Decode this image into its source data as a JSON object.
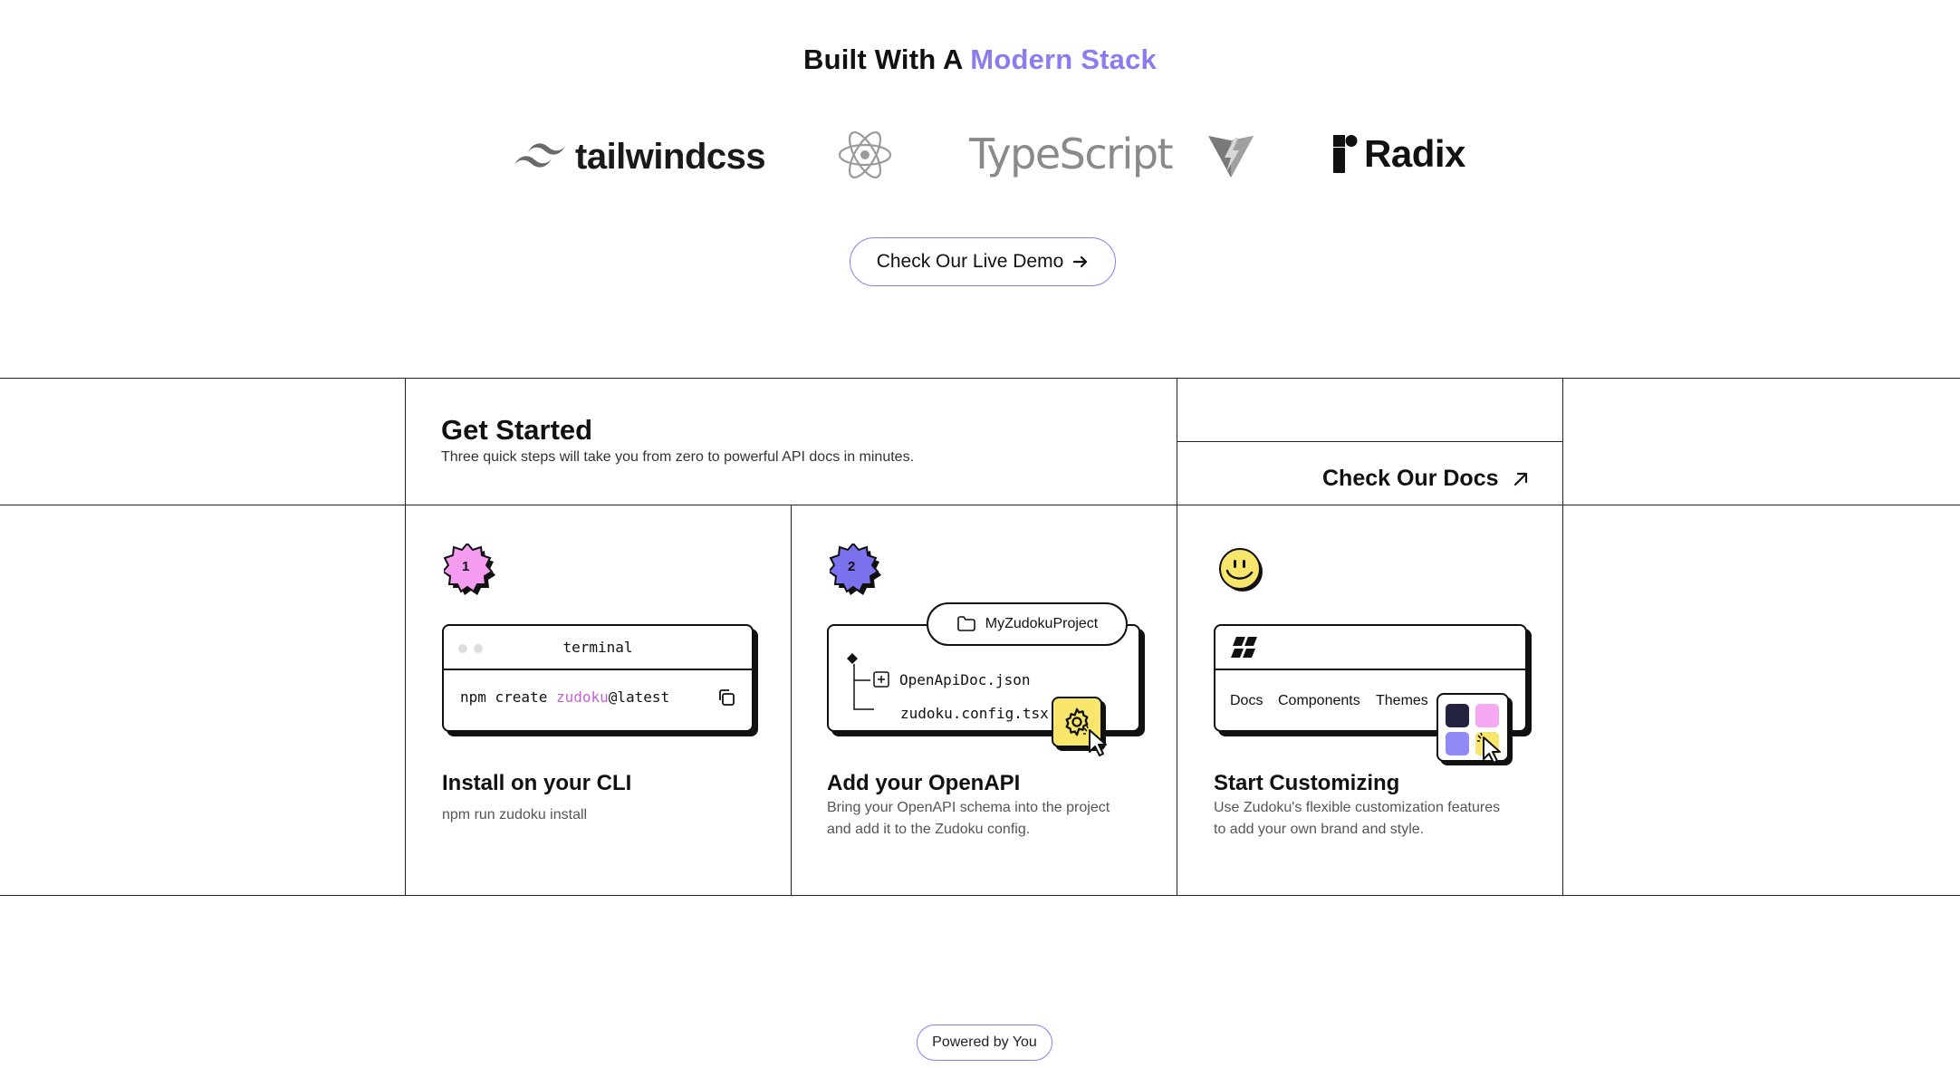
{
  "stack": {
    "title_prefix": "Built With A",
    "title_accent": "Modern Stack",
    "logos": [
      {
        "name": "tailwindcss",
        "label": "tailwindcss"
      },
      {
        "name": "react",
        "label": ""
      },
      {
        "name": "typescript",
        "label": "TypeScript"
      },
      {
        "name": "vite",
        "label": ""
      },
      {
        "name": "radix",
        "label": "Radix"
      }
    ],
    "demo_button": "Check Our Live Demo",
    "demo_icon": "arrow-right-icon"
  },
  "get_started": {
    "title": "Get Started",
    "subtitle": "Three quick steps will take you from zero to powerful API docs in minutes.",
    "docs_link": "Check Our Docs",
    "docs_icon": "arrow-up-right-icon"
  },
  "cards": [
    {
      "step": "1",
      "badge_color": "#F49CF0",
      "terminal_label": "terminal",
      "command_prefix": "npm create ",
      "command_highlight": "zudoku",
      "command_suffix": "@latest",
      "highlight_color": "#C860D8",
      "title": "Install on your CLI",
      "desc": "npm run zudoku install"
    },
    {
      "step": "2",
      "badge_color": "#7B72F0",
      "project_name": "MyZudokuProject",
      "file_1": "OpenApiDoc.json",
      "file_2": "zudoku.config.tsx",
      "title": "Add your OpenAPI",
      "desc_1": "Bring your OpenAPI schema into the project",
      "desc_2": "and add it to the Zudoku config."
    },
    {
      "smiley_color": "#F7E66B",
      "tabs": [
        "Docs",
        "Components",
        "Themes"
      ],
      "swatches": [
        "#23233F",
        "#F7A8F2",
        "#8F8AF5",
        "#F7E66B"
      ],
      "title": "Start Customizing",
      "desc_1": "Use Zudoku's flexible customization features",
      "desc_2": "to add your own brand and style."
    }
  ],
  "footer": {
    "powered_by": "Powered by You"
  }
}
